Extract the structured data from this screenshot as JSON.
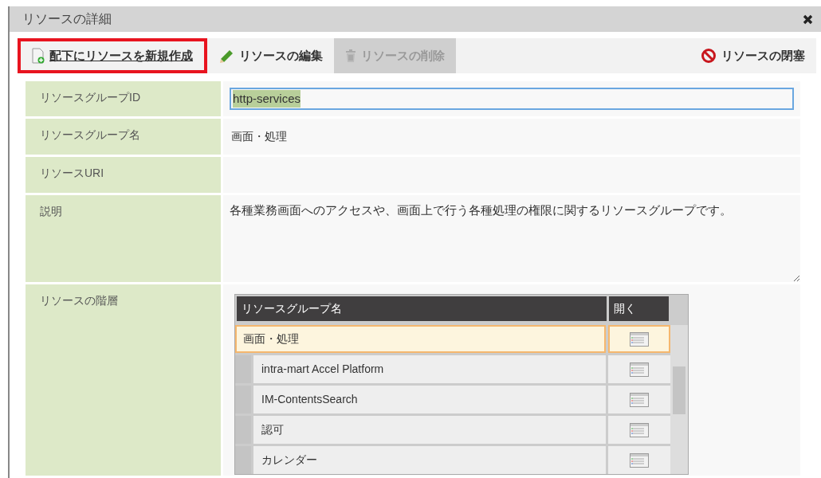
{
  "window": {
    "title": "リソースの詳細"
  },
  "toolbar": [
    {
      "kind": "create",
      "label": "配下にリソースを新規作成",
      "highlighted": true,
      "disabled": false
    },
    {
      "kind": "edit",
      "label": "リソースの編集",
      "highlighted": false,
      "disabled": false
    },
    {
      "kind": "delete",
      "label": "リソースの削除",
      "highlighted": false,
      "disabled": true
    },
    {
      "kind": "block",
      "label": "リソースの閉塞",
      "highlighted": false,
      "disabled": false
    }
  ],
  "fields": [
    {
      "kind": "input",
      "label": "リソースグループID",
      "value": "http-services",
      "value_selected": true
    },
    {
      "kind": "text",
      "label": "リソースグループ名",
      "value": "画面・処理"
    },
    {
      "kind": "text",
      "label": "リソースURI"
    },
    {
      "kind": "textarea",
      "label": "説明",
      "value": "各種業務画面へのアクセスや、画面上で行う各種処理の権限に関するリソースグループです。"
    },
    {
      "kind": "tree",
      "label": "リソースの階層"
    }
  ],
  "hierarchy": {
    "columns": [
      "リソースグループ名",
      "開く"
    ],
    "rows": [
      {
        "name": "画面・処理",
        "selected": true,
        "children": [
          {
            "name": "intra-mart Accel Platform",
            "selected": false
          },
          {
            "name": "IM-ContentsSearch",
            "selected": false
          },
          {
            "name": "認可",
            "selected": false
          },
          {
            "name": "カレンダー",
            "selected": false
          }
        ]
      }
    ]
  }
}
